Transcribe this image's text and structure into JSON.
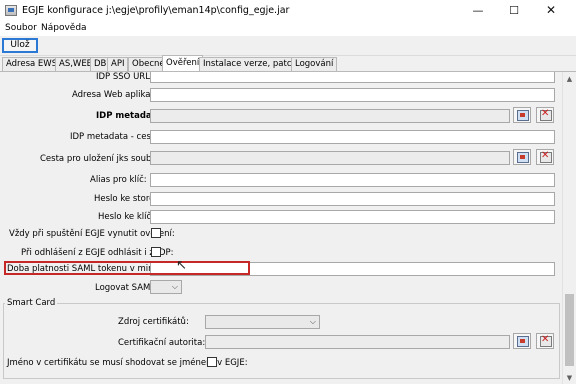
{
  "window": {
    "title": "EGJE konfigurace j:\\egje\\profily\\eman14p\\config_egje.jar",
    "minimize_glyph": "—",
    "maximize_glyph": "☐",
    "close_glyph": "✕"
  },
  "menu": {
    "items": [
      "Soubor",
      "Nápověda"
    ]
  },
  "toolbar": {
    "save_label": "Ulož"
  },
  "tabs": [
    {
      "label": "Adresa EWS"
    },
    {
      "label": "AS,WEB"
    },
    {
      "label": "DB"
    },
    {
      "label": "API"
    },
    {
      "label": "Obecné"
    },
    {
      "label": "Ověření",
      "active": true
    },
    {
      "label": "Instalace verze, patche"
    },
    {
      "label": "Logování"
    }
  ],
  "form": {
    "idp_sso_url_label": "IDP SSO URL:",
    "web_app_address_label": "Adresa Web aplikace:",
    "idp_metadata_label": "IDP metadata:",
    "idp_metadata_path_label": "IDP metadata - cesta:",
    "jks_path_label": "Cesta pro uložení jks souboru:",
    "key_alias_label": "Alias pro klíč:",
    "store_password_label": "Heslo ke store:",
    "key_password_label": "Heslo ke klíči:",
    "force_auth_label": "Vždy při spuštění EGJE vynutit ověření:",
    "idp_logout_label": "Při odhlášení z EGJE odhlásit i z IDP:",
    "saml_token_validity_label": "Doba platnosti SAML tokenu v minutách:",
    "saml_token_validity_value": "",
    "log_saml_label": "Logovat SAML:"
  },
  "smart_card": {
    "title": "Smart Card",
    "cert_source_label": "Zdroj certifikátů:",
    "cert_authority_label": "Certifikační autorita:",
    "name_match_label": "Jméno v certifikátu se musí shodovat se jménem v EGJE:"
  },
  "icons": {
    "app": "app-icon",
    "select": "open-file-icon",
    "delete": "delete-icon",
    "combo": "chevron-down-icon",
    "cursor": "mouse-pointer-icon"
  },
  "colors": {
    "focus_border": "#2b79d3",
    "highlight_border": "#c62828",
    "panel_bg": "#f0f0f0"
  }
}
